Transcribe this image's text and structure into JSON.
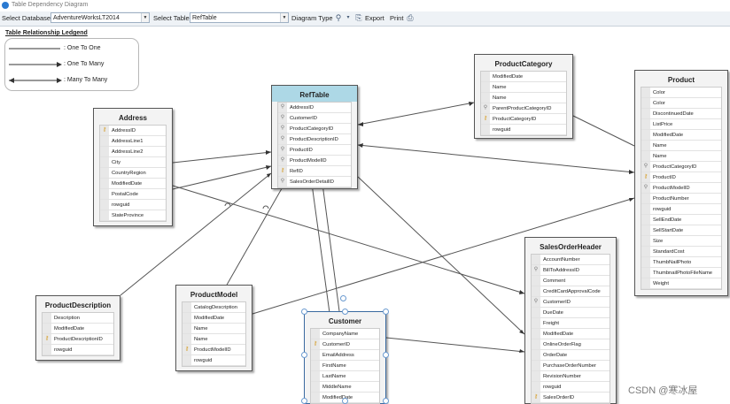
{
  "window": {
    "title": "Table Dependency Diagram"
  },
  "toolbar": {
    "select_database_label": "Select Database",
    "database_value": "AdventureWorksLT2014",
    "select_table_label": "Select Table",
    "table_value": "RefTable",
    "diagram_type_label": "Diagram Type",
    "export_label": "Export",
    "print_label": "Print"
  },
  "legend": {
    "title": "Table Relationship Ledgend",
    "one_to_one": ": One To One",
    "one_to_many": ": One To Many",
    "many_to_many": ": Many To Many"
  },
  "tables": {
    "reftable": {
      "name": "RefTable",
      "columns": [
        {
          "name": "AddressID",
          "key": "fk"
        },
        {
          "name": "CustomerID",
          "key": "fk"
        },
        {
          "name": "ProductCategoryID",
          "key": "fk"
        },
        {
          "name": "ProductDescriptionID",
          "key": "fk"
        },
        {
          "name": "ProductID",
          "key": "fk"
        },
        {
          "name": "ProductModelID",
          "key": "fk"
        },
        {
          "name": "RefID",
          "key": "pk"
        },
        {
          "name": "SalesOrderDetailID",
          "key": "fk"
        }
      ]
    },
    "address": {
      "name": "Address",
      "columns": [
        {
          "name": "AddressID",
          "key": "pk"
        },
        {
          "name": "AddressLine1",
          "key": ""
        },
        {
          "name": "AddressLine2",
          "key": ""
        },
        {
          "name": "City",
          "key": ""
        },
        {
          "name": "CountryRegion",
          "key": ""
        },
        {
          "name": "ModifiedDate",
          "key": ""
        },
        {
          "name": "PostalCode",
          "key": ""
        },
        {
          "name": "rowguid",
          "key": ""
        },
        {
          "name": "StateProvince",
          "key": ""
        }
      ]
    },
    "productcategory": {
      "name": "ProductCategory",
      "columns": [
        {
          "name": "ModifiedDate",
          "key": ""
        },
        {
          "name": "Name",
          "key": ""
        },
        {
          "name": "Name",
          "key": ""
        },
        {
          "name": "ParentProductCategoryID",
          "key": "fk"
        },
        {
          "name": "ProductCategoryID",
          "key": "pk"
        },
        {
          "name": "rowguid",
          "key": ""
        }
      ]
    },
    "product": {
      "name": "Product",
      "columns": [
        {
          "name": "Color",
          "key": ""
        },
        {
          "name": "Color",
          "key": ""
        },
        {
          "name": "DiscontinuedDate",
          "key": ""
        },
        {
          "name": "ListPrice",
          "key": ""
        },
        {
          "name": "ModifiedDate",
          "key": ""
        },
        {
          "name": "Name",
          "key": ""
        },
        {
          "name": "Name",
          "key": ""
        },
        {
          "name": "ProductCategoryID",
          "key": "fk"
        },
        {
          "name": "ProductID",
          "key": "pk"
        },
        {
          "name": "ProductModelID",
          "key": "fk"
        },
        {
          "name": "ProductNumber",
          "key": ""
        },
        {
          "name": "rowguid",
          "key": ""
        },
        {
          "name": "SellEndDate",
          "key": ""
        },
        {
          "name": "SellStartDate",
          "key": ""
        },
        {
          "name": "Size",
          "key": ""
        },
        {
          "name": "StandardCost",
          "key": ""
        },
        {
          "name": "ThumbNailPhoto",
          "key": ""
        },
        {
          "name": "ThumbnailPhotoFileName",
          "key": ""
        },
        {
          "name": "Weight",
          "key": ""
        }
      ]
    },
    "productdescription": {
      "name": "ProductDescription",
      "columns": [
        {
          "name": "Description",
          "key": ""
        },
        {
          "name": "ModifiedDate",
          "key": ""
        },
        {
          "name": "ProductDescriptionID",
          "key": "pk"
        },
        {
          "name": "rowguid",
          "key": ""
        }
      ]
    },
    "productmodel": {
      "name": "ProductModel",
      "columns": [
        {
          "name": "CatalogDescription",
          "key": ""
        },
        {
          "name": "ModifiedDate",
          "key": ""
        },
        {
          "name": "Name",
          "key": ""
        },
        {
          "name": "Name",
          "key": ""
        },
        {
          "name": "ProductModelID",
          "key": "pk"
        },
        {
          "name": "rowguid",
          "key": ""
        }
      ]
    },
    "customer": {
      "name": "Customer",
      "columns": [
        {
          "name": "CompanyName",
          "key": ""
        },
        {
          "name": "CustomerID",
          "key": "pk"
        },
        {
          "name": "EmailAddress",
          "key": ""
        },
        {
          "name": "FirstName",
          "key": ""
        },
        {
          "name": "LastName",
          "key": ""
        },
        {
          "name": "MiddleName",
          "key": ""
        },
        {
          "name": "ModifiedDate",
          "key": ""
        }
      ]
    },
    "salesorderheader": {
      "name": "SalesOrderHeader",
      "columns": [
        {
          "name": "AccountNumber",
          "key": ""
        },
        {
          "name": "BillToAddressID",
          "key": "fk"
        },
        {
          "name": "Comment",
          "key": ""
        },
        {
          "name": "CreditCardApprovalCode",
          "key": ""
        },
        {
          "name": "CustomerID",
          "key": "fk"
        },
        {
          "name": "DueDate",
          "key": ""
        },
        {
          "name": "Freight",
          "key": ""
        },
        {
          "name": "ModifiedDate",
          "key": ""
        },
        {
          "name": "OnlineOrderFlag",
          "key": ""
        },
        {
          "name": "OrderDate",
          "key": ""
        },
        {
          "name": "PurchaseOrderNumber",
          "key": ""
        },
        {
          "name": "RevisionNumber",
          "key": ""
        },
        {
          "name": "rowguid",
          "key": ""
        },
        {
          "name": "SalesOrderID",
          "key": "pk"
        }
      ]
    }
  },
  "watermark": "CSDN @寒冰屋"
}
